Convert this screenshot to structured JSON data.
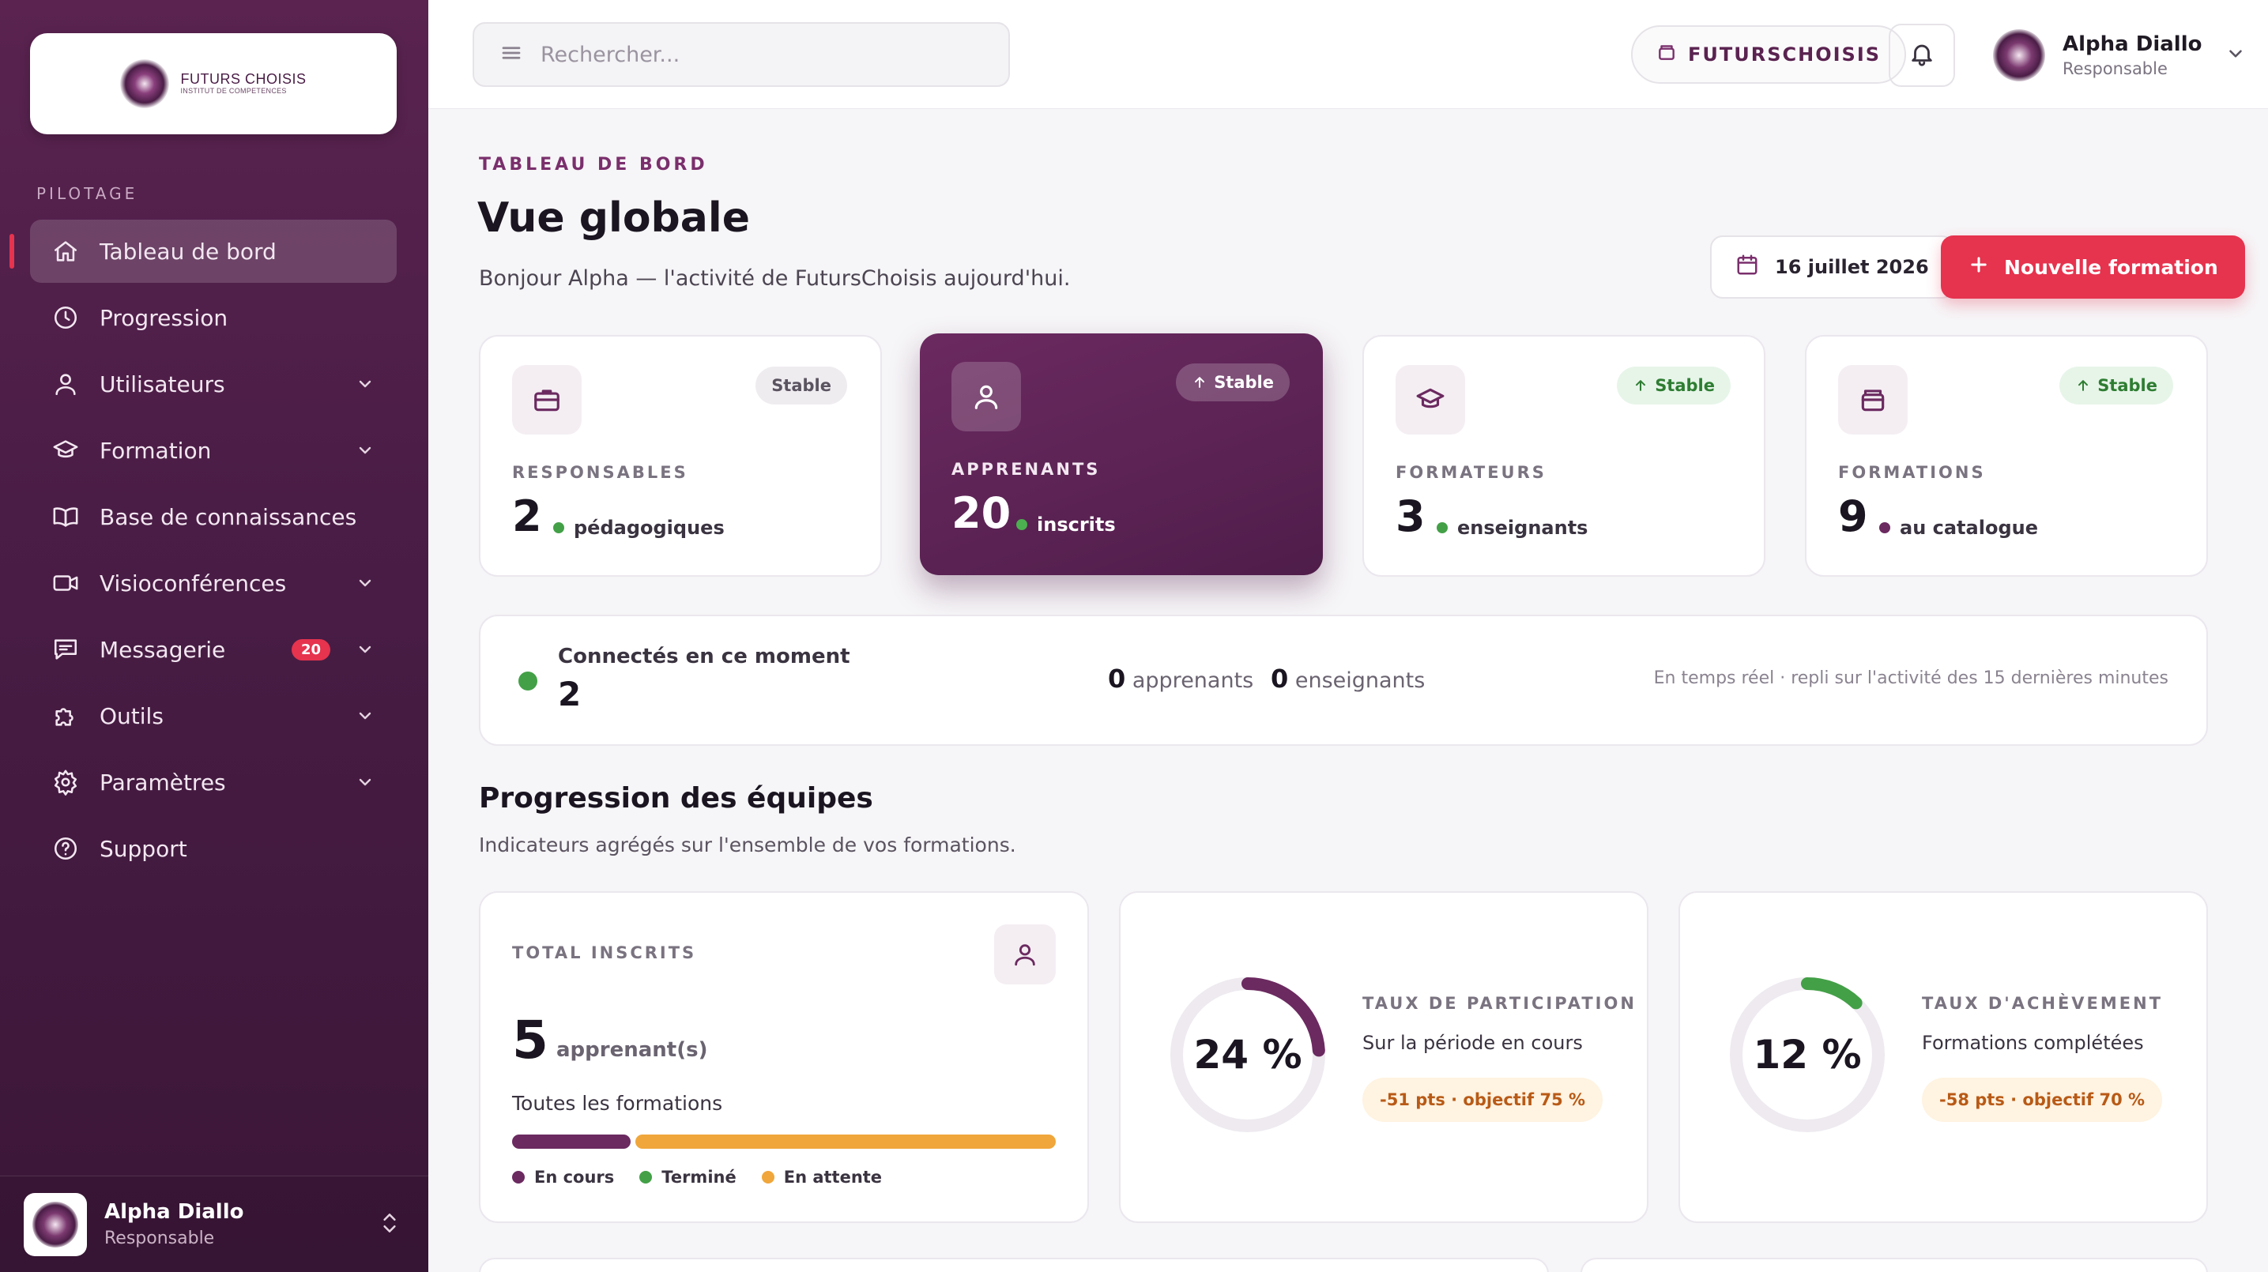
{
  "brand": {
    "logo_name": "FUTURS CHOISIS",
    "logo_sub": "INSTITUT DE COMPETENCES"
  },
  "sidebar": {
    "section": "PILOTAGE",
    "items": [
      {
        "label": "Tableau de bord",
        "icon": "home-icon"
      },
      {
        "label": "Progression",
        "icon": "clock-icon"
      },
      {
        "label": "Utilisateurs",
        "icon": "user-icon"
      },
      {
        "label": "Formation",
        "icon": "graduation-cap-icon"
      },
      {
        "label": "Base de connaissances",
        "icon": "book-icon"
      },
      {
        "label": "Visioconférences",
        "icon": "video-icon"
      },
      {
        "label": "Messagerie",
        "icon": "message-icon",
        "badge": "20"
      },
      {
        "label": "Outils",
        "icon": "puzzle-icon"
      },
      {
        "label": "Paramètres",
        "icon": "gear-icon"
      },
      {
        "label": "Support",
        "icon": "help-icon"
      }
    ],
    "footer": {
      "name": "Alpha Diallo",
      "role": "Responsable"
    }
  },
  "topbar": {
    "search_placeholder": "Rechercher...",
    "org": "FUTURSCHOISIS",
    "user_name": "Alpha Diallo",
    "user_role": "Responsable"
  },
  "header": {
    "eyebrow": "TABLEAU DE BORD",
    "title": "Vue globale",
    "subtitle": "Bonjour Alpha — l'activité de FutursChoisis aujourd'hui.",
    "date": "16 juillet 2026",
    "new_button": "Nouvelle formation"
  },
  "stats": [
    {
      "label": "RESPONSABLES",
      "value": "2",
      "sub": "pédagogiques",
      "trend": "Stable",
      "icon": "briefcase-icon",
      "dot_color": "#43a047"
    },
    {
      "label": "APPRENANTS",
      "value": "20",
      "sub": "inscrits",
      "trend": "Stable",
      "icon": "user-icon",
      "dot_color": "#4caf50"
    },
    {
      "label": "FORMATEURS",
      "value": "3",
      "sub": "enseignants",
      "trend": "Stable",
      "icon": "graduation-cap-icon",
      "dot_color": "#43a047"
    },
    {
      "label": "FORMATIONS",
      "value": "9",
      "sub": "au catalogue",
      "trend": "Stable",
      "icon": "archive-icon",
      "dot_color": "#6b2a60"
    }
  ],
  "live": {
    "title": "Connectés en ce moment",
    "count": "2",
    "learners_value": "0",
    "learners_label": "apprenants",
    "teachers_value": "0",
    "teachers_label": "enseignants",
    "note": "En temps réel · repli sur l'activité des 15 dernières minutes"
  },
  "progress": {
    "title": "Progression des équipes",
    "subtitle": "Indicateurs agrégés sur l'ensemble de vos formations.",
    "total": {
      "eyebrow": "TOTAL INSCRITS",
      "value": "5",
      "unit": "apprenant(s)",
      "sub": "Toutes les formations",
      "bar": [
        {
          "label": "En cours",
          "share": 0.22,
          "color": "#6b2a60"
        },
        {
          "label": "Terminé",
          "share": 0.0,
          "color": "#43a047"
        },
        {
          "label": "En attente",
          "share": 0.78,
          "color": "#f0a63a"
        }
      ]
    },
    "participation": {
      "value_text": "24 %",
      "value": 0.24,
      "eyebrow": "TAUX DE PARTICIPATION",
      "desc": "Sur la période en cours",
      "pill": "-51 pts · objectif 75 %",
      "color": "#6b2a60"
    },
    "completion": {
      "value_text": "12 %",
      "value": 0.12,
      "eyebrow": "TAUX D'ACHÈVEMENT",
      "desc": "Formations complétées",
      "pill": "-58 pts · objectif 70 %",
      "color": "#43a047"
    }
  },
  "colors": {
    "accent": "#e6334e",
    "primary": "#5a2350",
    "success": "#43a047",
    "warning": "#f0a63a"
  }
}
